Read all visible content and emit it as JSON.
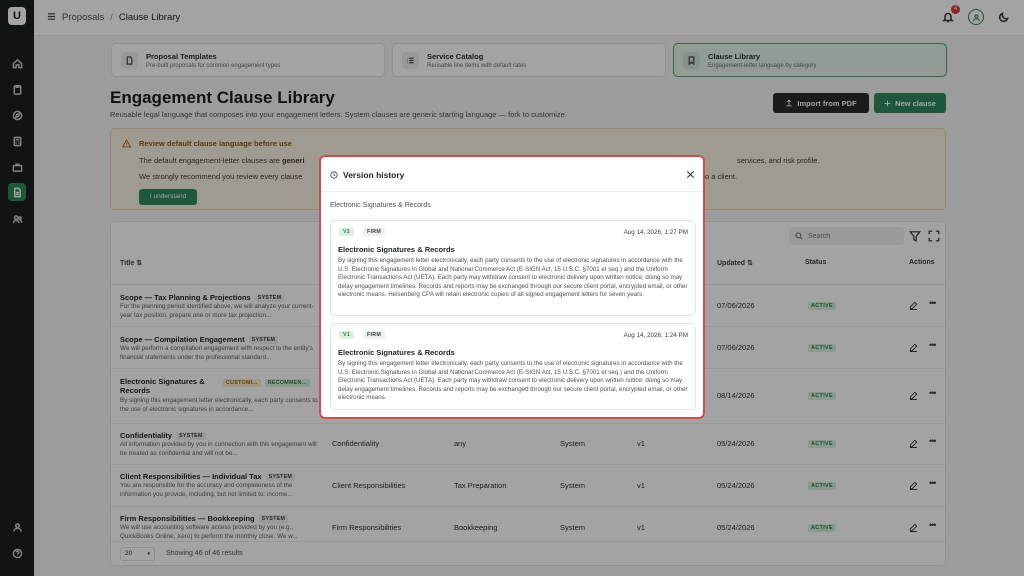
{
  "breadcrumb": {
    "parent": "Proposals",
    "separator": "/",
    "current": "Clause Library"
  },
  "topbar": {
    "notification_count": "4"
  },
  "nav_cards": [
    {
      "title": "Proposal Templates",
      "desc": "Pre-built proposals for common engagement types",
      "icon": "document-icon"
    },
    {
      "title": "Service Catalog",
      "desc": "Reusable line items with default rates",
      "icon": "list-icon"
    },
    {
      "title": "Clause Library",
      "desc": "Engagement-letter language by category",
      "icon": "bookmark-icon"
    }
  ],
  "page": {
    "title": "Engagement Clause Library",
    "subtitle": "Reusable legal language that composes into your engagement letters. System clauses are generic starting language — fork to customize.",
    "import_label": "Import from PDF",
    "new_label": "New clause"
  },
  "banner": {
    "title": "Review default clause language before use",
    "p1_a": "The default engagement-letter clauses are ",
    "p1_b": "generi",
    "p1_c": "services, and risk profile.",
    "p2_a": "We strongly recommend you review every clause",
    "p2_b": "o a client.",
    "button": "I understand"
  },
  "table": {
    "search_placeholder": "Search",
    "headers": {
      "title": "Title",
      "updated": "Updated",
      "status": "Status",
      "actions": "Actions"
    },
    "rows": [
      {
        "title": "Scope — Tax Planning & Projections",
        "tags": [
          "SYSTEM"
        ],
        "desc": "For the planning period identified above, we will analyze your current-year tax position, prepare one or more tax projection...",
        "category": "",
        "service": "",
        "source": "",
        "version": "",
        "updated": "07/06/2026",
        "status": "ACTIVE"
      },
      {
        "title": "Scope — Compilation Engagement",
        "tags": [
          "SYSTEM"
        ],
        "desc": "We will perform a compilation engagement with respect to the entity's financial statements under the professional standard...",
        "category": "",
        "service": "",
        "source": "",
        "version": "",
        "updated": "07/06/2026",
        "status": "ACTIVE"
      },
      {
        "title": "Electronic Signatures & Records",
        "tags": [
          "CUSTOMI...",
          "RECOMMEN..."
        ],
        "desc": "By signing this engagement letter electronically, each party consents to the use of electronic signatures in accordance...",
        "category": "",
        "service": "",
        "source": "",
        "version": "",
        "updated": "08/14/2026",
        "status": "ACTIVE"
      },
      {
        "title": "Confidentiality",
        "tags": [
          "SYSTEM"
        ],
        "desc": "All information provided by you in connection with this engagement will be treated as confidential and will not be...",
        "category": "Confidentiality",
        "service": "any",
        "source": "System",
        "version": "v1",
        "updated": "05/24/2026",
        "status": "ACTIVE"
      },
      {
        "title": "Client Responsibilities — Individual Tax",
        "tags": [
          "SYSTEM"
        ],
        "desc": "You are responsible for the accuracy and completeness of the information you provide, including, but not limited to: income...",
        "category": "Client Responsibilities",
        "service": "Tax Preparation",
        "source": "System",
        "version": "v1",
        "updated": "05/24/2026",
        "status": "ACTIVE"
      },
      {
        "title": "Firm Responsibilities — Bookkeeping",
        "tags": [
          "SYSTEM"
        ],
        "desc": "We will use accounting software access provided by you (e.g., QuickBooks Online, Xero) to perform the monthly close. We w...",
        "category": "Firm Responsibilities",
        "service": "Bookkeeping",
        "source": "System",
        "version": "v1",
        "updated": "05/24/2026",
        "status": "ACTIVE"
      }
    ],
    "page_size": "20",
    "results_text": "Showing 46 of 46 results"
  },
  "modal": {
    "title": "Version history",
    "subtitle": "Electronic Signatures & Records",
    "versions": [
      {
        "version": "V2",
        "scope": "FIRM",
        "date": "Aug 14, 2026, 1:27 PM",
        "title": "Electronic Signatures & Records",
        "body": "By signing this engagement letter electronically, each party consents to the use of electronic signatures in accordance with the U.S. Electronic Signatures in Global and National Commerce Act (E-SIGN Act, 15 U.S.C. §7001 et seq.) and the Uniform Electronic Transactions Act (UETA). Each party may withdraw consent to electronic delivery upon written notice; doing so may delay engagement timelines. Records and reports may be exchanged through our secure client portal, encrypted email, or other electronic means. Heisenberg CPA will retain electronic copies of all signed engagement letters for seven years."
      },
      {
        "version": "V1",
        "scope": "FIRM",
        "date": "Aug 14, 2026, 1:24 PM",
        "title": "Electronic Signatures & Records",
        "body": "By signing this engagement letter electronically, each party consents to the use of electronic signatures in accordance with the U.S. Electronic Signatures in Global and National Commerce Act (E-SIGN Act, 15 U.S.C. §7001 et seq.) and the Uniform Electronic Transactions Act (UETA). Each party may withdraw consent to electronic delivery upon written notice; doing so may delay engagement timelines. Records and reports may be exchanged through our secure client portal, encrypted email, or other electronic means."
      }
    ]
  }
}
